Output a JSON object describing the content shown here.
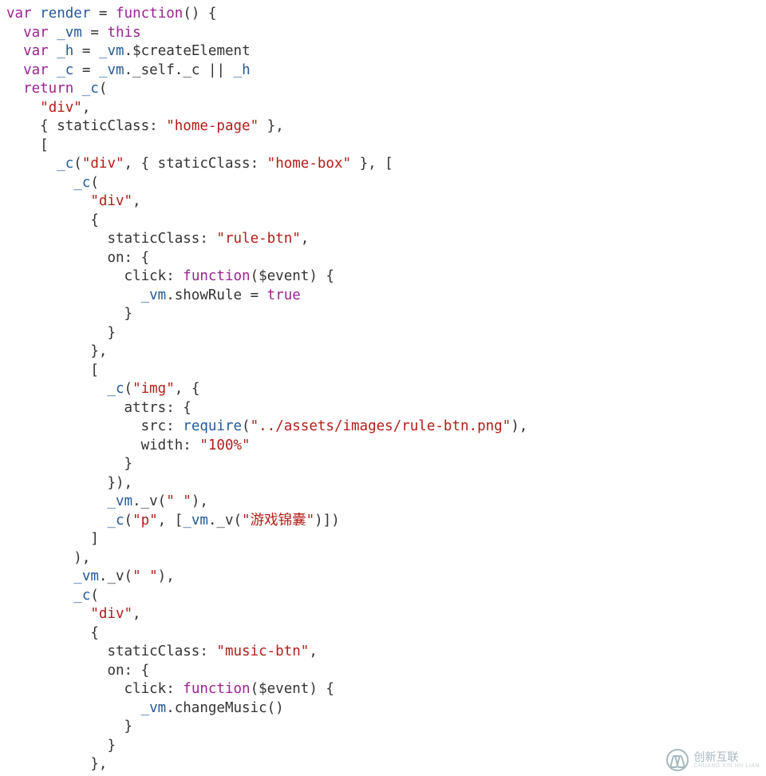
{
  "code": {
    "l01": {
      "a": "var",
      "b": "render",
      "c": "=",
      "d": "function",
      "e": "() {"
    },
    "l02": {
      "a": "var",
      "b": "_vm",
      "c": "=",
      "d": "this"
    },
    "l03": {
      "a": "var",
      "b": "_h",
      "c": "=",
      "d": "_vm",
      "e": ".$createElement"
    },
    "l04": {
      "a": "var",
      "b": "_c",
      "c": "=",
      "d": "_vm",
      "e": "._self._c",
      "f": "||",
      "g": "_h"
    },
    "l05": {
      "a": "return",
      "b": "_c",
      "c": "("
    },
    "l06": {
      "a": "\"div\"",
      "b": ","
    },
    "l07": {
      "a": "{ staticClass:",
      "b": "\"home-page\"",
      "c": "},"
    },
    "l08": {
      "a": "["
    },
    "l09": {
      "a": "_c",
      "b": "(",
      "c": "\"div\"",
      "d": ", { staticClass:",
      "e": "\"home-box\"",
      "f": "}, ["
    },
    "l10": {
      "a": "_c",
      "b": "("
    },
    "l11": {
      "a": "\"div\"",
      "b": ","
    },
    "l12": {
      "a": "{"
    },
    "l13": {
      "a": "staticClass:",
      "b": "\"rule-btn\"",
      "c": ","
    },
    "l14": {
      "a": "on: {"
    },
    "l15": {
      "a": "click:",
      "b": "function",
      "c": "($event) {"
    },
    "l16": {
      "a": "_vm",
      "b": ".showRule",
      "c": "=",
      "d": "true"
    },
    "l17": {
      "a": "}"
    },
    "l18": {
      "a": "}"
    },
    "l19": {
      "a": "},"
    },
    "l20": {
      "a": "["
    },
    "l21": {
      "a": "_c",
      "b": "(",
      "c": "\"img\"",
      "d": ", {"
    },
    "l22": {
      "a": "attrs: {"
    },
    "l23": {
      "a": "src:",
      "b": "require",
      "c": "(",
      "d": "\"../assets/images/rule-btn.png\"",
      "e": "),"
    },
    "l24": {
      "a": "width:",
      "b": "\"100%\""
    },
    "l25": {
      "a": "}"
    },
    "l26": {
      "a": "}),"
    },
    "l27": {
      "a": "_vm",
      "b": "._v(",
      "c": "\" \"",
      "d": "),"
    },
    "l28": {
      "a": "_c",
      "b": "(",
      "c": "\"p\"",
      "d": ", [",
      "e": "_vm",
      "f": "._v(",
      "g": "\"游戏锦囊\"",
      "h": ")])"
    },
    "l29": {
      "a": "]"
    },
    "l30": {
      "a": "),"
    },
    "l31": {
      "a": "_vm",
      "b": "._v(",
      "c": "\" \"",
      "d": "),"
    },
    "l32": {
      "a": "_c",
      "b": "("
    },
    "l33": {
      "a": "\"div\"",
      "b": ","
    },
    "l34": {
      "a": "{"
    },
    "l35": {
      "a": "staticClass:",
      "b": "\"music-btn\"",
      "c": ","
    },
    "l36": {
      "a": "on: {"
    },
    "l37": {
      "a": "click:",
      "b": "function",
      "c": "($event) {"
    },
    "l38": {
      "a": "_vm",
      "b": ".changeMusic()"
    },
    "l39": {
      "a": "}"
    },
    "l40": {
      "a": "}"
    },
    "l41": {
      "a": "},"
    }
  },
  "watermark": {
    "text": "创新互联",
    "sub": "CHUANG XIN HU LIAN"
  }
}
